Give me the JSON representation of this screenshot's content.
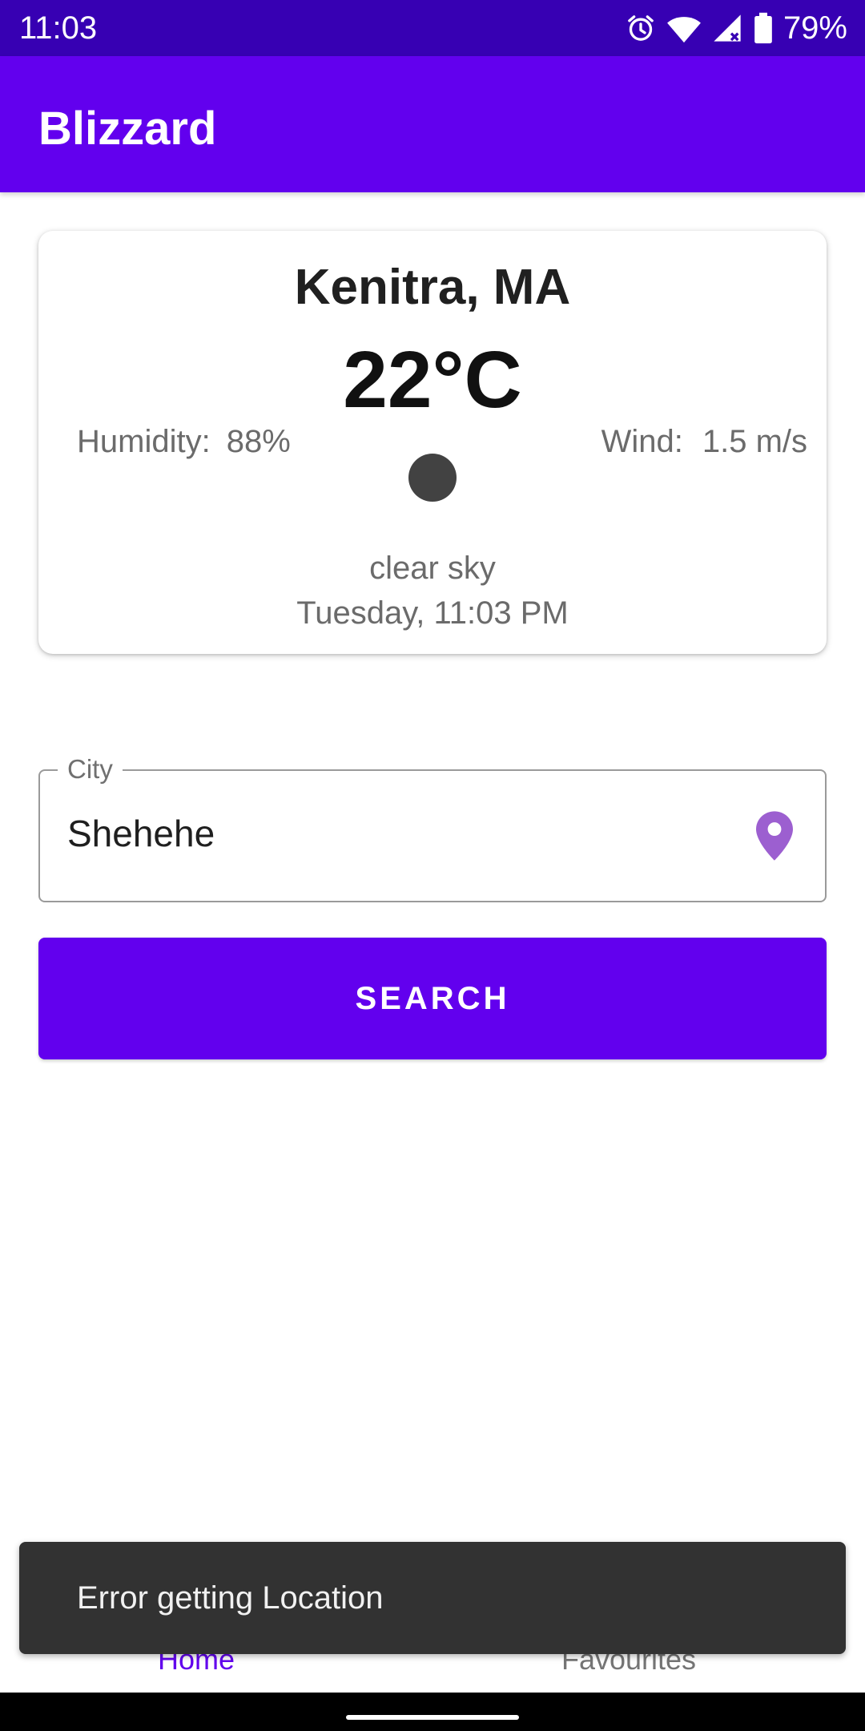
{
  "status_bar": {
    "time": "11:03",
    "battery_percent": "79%",
    "icons": [
      "alarm-icon",
      "wifi-icon",
      "cell-signal-icon",
      "battery-icon"
    ]
  },
  "app_bar": {
    "title": "Blizzard"
  },
  "weather": {
    "city": "Kenitra, MA",
    "temperature": "22°C",
    "humidity_label": "Humidity:",
    "humidity_value": "88%",
    "wind_label": "Wind:",
    "wind_value": "1.5 m/s",
    "condition": "clear sky",
    "datetime": "Tuesday, 11:03 PM",
    "icon": "weather-icon"
  },
  "city_field": {
    "label": "City",
    "value": "Shehehe",
    "icon": "location-pin-icon",
    "icon_color": "#9C5FD0"
  },
  "search_button": {
    "label": "SEARCH"
  },
  "bottom_nav": {
    "items": [
      {
        "label": "Home",
        "active": true
      },
      {
        "label": "Favourites",
        "active": false
      }
    ]
  },
  "snackbar": {
    "message": "Error getting Location"
  },
  "colors": {
    "primary": "#6200EE",
    "primary_dark": "#3700B3",
    "snackbar_bg": "#323232"
  }
}
